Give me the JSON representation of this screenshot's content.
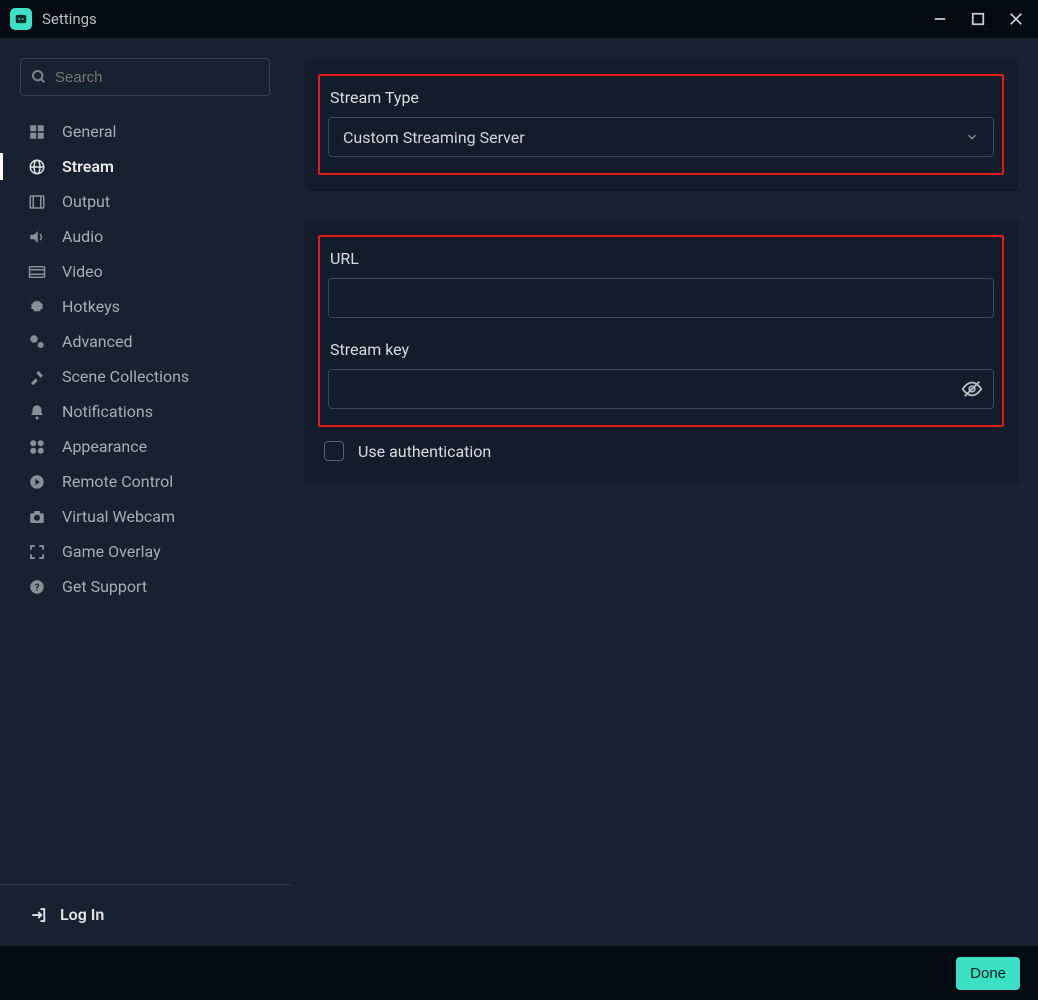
{
  "window": {
    "title": "Settings"
  },
  "search": {
    "placeholder": "Search"
  },
  "sidebar": {
    "items": [
      {
        "label": "General"
      },
      {
        "label": "Stream"
      },
      {
        "label": "Output"
      },
      {
        "label": "Audio"
      },
      {
        "label": "Video"
      },
      {
        "label": "Hotkeys"
      },
      {
        "label": "Advanced"
      },
      {
        "label": "Scene Collections"
      },
      {
        "label": "Notifications"
      },
      {
        "label": "Appearance"
      },
      {
        "label": "Remote Control"
      },
      {
        "label": "Virtual Webcam"
      },
      {
        "label": "Game Overlay"
      },
      {
        "label": "Get Support"
      }
    ],
    "login": "Log In"
  },
  "main": {
    "stream_type": {
      "label": "Stream Type",
      "selected": "Custom Streaming Server"
    },
    "url": {
      "label": "URL",
      "value": ""
    },
    "stream_key": {
      "label": "Stream key",
      "value": ""
    },
    "use_authentication": {
      "label": "Use authentication",
      "checked": false
    }
  },
  "footer": {
    "done": "Done"
  },
  "colors": {
    "accent": "#3be0c5",
    "highlight": "#e11d1d"
  }
}
